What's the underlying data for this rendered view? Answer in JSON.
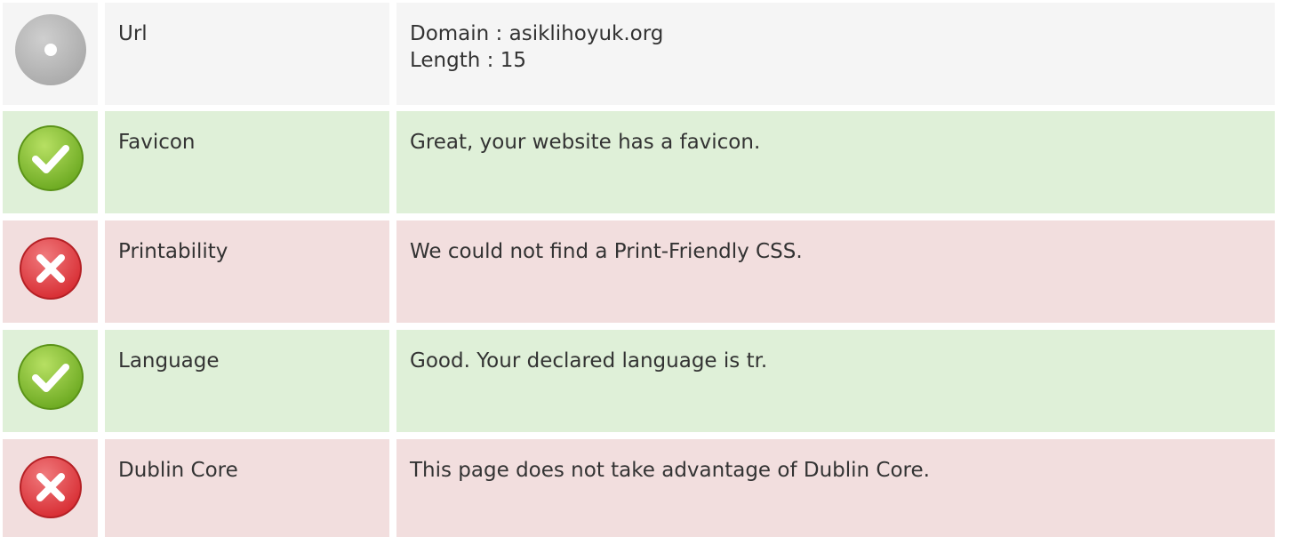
{
  "rows": [
    {
      "status": "neutral",
      "icon": "neutral-info-icon",
      "label": "Url",
      "lines": [
        "Domain : asiklihoyuk.org",
        "Length : 15"
      ]
    },
    {
      "status": "pass",
      "icon": "check-icon",
      "label": "Favicon",
      "lines": [
        "Great, your website has a favicon."
      ]
    },
    {
      "status": "fail",
      "icon": "cross-icon",
      "label": "Printability",
      "lines": [
        "We could not find a Print-Friendly CSS."
      ]
    },
    {
      "status": "pass",
      "icon": "check-icon",
      "label": "Language",
      "lines": [
        "Good. Your declared language is tr."
      ]
    },
    {
      "status": "fail",
      "icon": "cross-icon",
      "label": "Dublin Core",
      "lines": [
        "This page does not take advantage of Dublin Core."
      ]
    }
  ],
  "colors": {
    "neutral_bg": "#f5f5f5",
    "pass_bg": "#dff0d8",
    "fail_bg": "#f2dede",
    "pass_icon": "#7cb82f",
    "fail_icon": "#e0393e",
    "neutral_icon": "#b3b3b3"
  }
}
